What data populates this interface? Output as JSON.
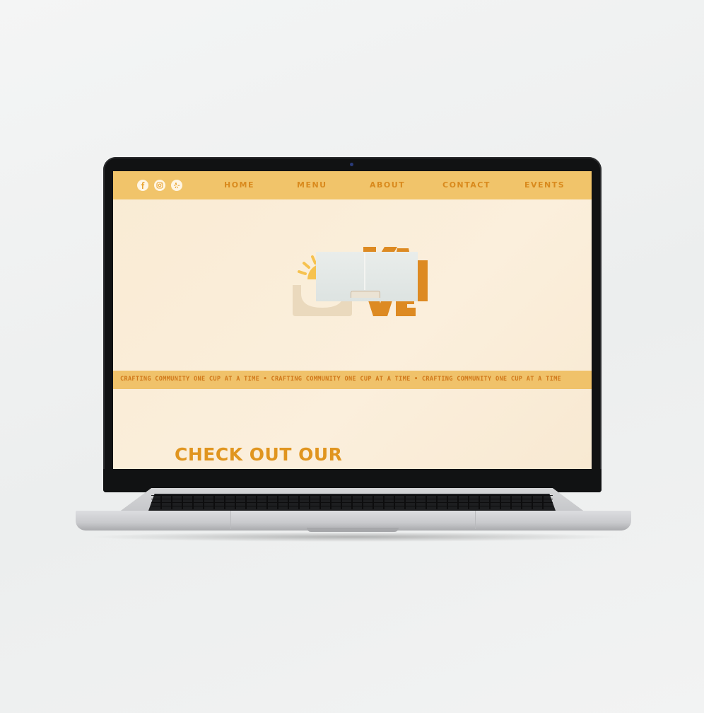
{
  "nav": {
    "social": [
      {
        "name": "facebook-icon"
      },
      {
        "name": "instagram-icon"
      },
      {
        "name": "yelp-icon"
      }
    ],
    "links": [
      "HOME",
      "MENU",
      "ABOUT",
      "CONTACT",
      "EVENTS"
    ]
  },
  "logo": {
    "text": "KAVE",
    "colors": {
      "sun": "#f6c24f",
      "cup": "#ead9bd",
      "letters": "#dd8a22"
    }
  },
  "ticker": {
    "text": "CRAFTING COMMUNITY ONE CUP AT A TIME • CRAFTING COMMUNITY ONE CUP AT A TIME • CRAFTING COMMUNITY ONE CUP AT A TIME"
  },
  "section": {
    "headline": "CHECK OUT OUR"
  },
  "colors": {
    "nav_bg": "#f1c46a",
    "accent": "#dd8a22",
    "page_bg": "#f9ebd4"
  }
}
